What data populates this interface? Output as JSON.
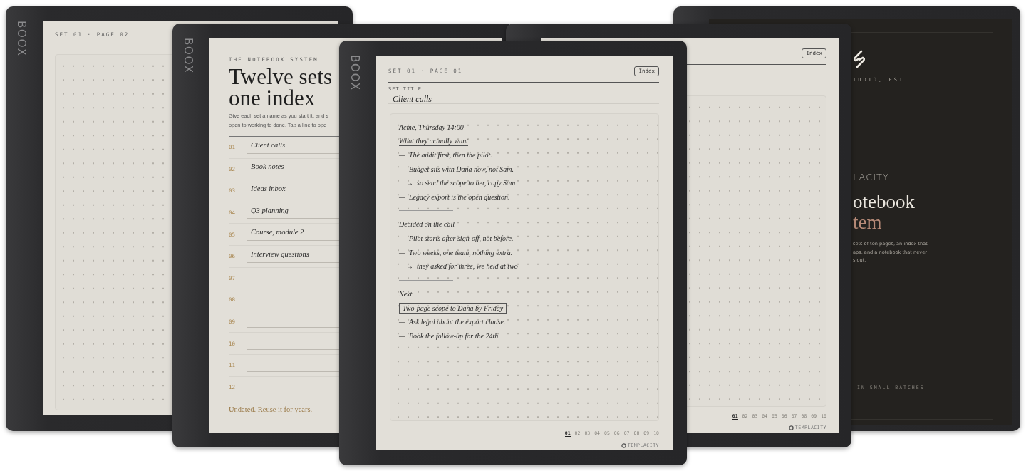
{
  "back_left_device": {
    "brand": "BOOX",
    "header": "SET 01 · PAGE 02"
  },
  "index_device": {
    "brand": "BOOX",
    "eyebrow": "THE NOTEBOOK SYSTEM",
    "title_lines": [
      "Twelve sets",
      "one index"
    ],
    "intro_lines": [
      "Give each set a name as you start it, and s",
      "open to working to done. Tap a line to ope"
    ],
    "rows": [
      {
        "number": "01",
        "name": "Client calls"
      },
      {
        "number": "02",
        "name": "Book notes"
      },
      {
        "number": "03",
        "name": "Ideas inbox"
      },
      {
        "number": "04",
        "name": "Q3 planning"
      },
      {
        "number": "05",
        "name": "Course, module 2"
      },
      {
        "number": "06",
        "name": "Interview questions"
      },
      {
        "number": "07"
      },
      {
        "number": "08"
      },
      {
        "number": "09"
      },
      {
        "number": "10"
      },
      {
        "number": "11"
      },
      {
        "number": "12"
      }
    ],
    "footer": "Undated. Reuse it for years."
  },
  "cover_device": {
    "studio_fragment": "TUDIO, EST.",
    "brand_fragment": "LACITY",
    "title_fragments": [
      "otebook",
      "tem"
    ],
    "intro_fragments": [
      "sets of ten pages, an index that",
      "aps, and a notebook that never",
      "s out."
    ],
    "tagline": "IN SMALL BATCHES"
  },
  "back_right_device": {
    "index_button": "Index",
    "pages": [
      {
        "label": "01",
        "selected": true
      },
      {
        "label": "02",
        "selected": false
      },
      {
        "label": "03",
        "selected": false
      },
      {
        "label": "04",
        "selected": false
      },
      {
        "label": "05",
        "selected": false
      },
      {
        "label": "06",
        "selected": false
      },
      {
        "label": "07",
        "selected": false
      },
      {
        "label": "08",
        "selected": false
      },
      {
        "label": "09",
        "selected": false
      },
      {
        "label": "10",
        "selected": false
      }
    ],
    "brand_mark": "TEMPLACITY"
  },
  "front_device": {
    "brand": "BOOX",
    "header": "SET 01 · PAGE 01",
    "index_button": "Index",
    "set_title_label": "SET TITLE",
    "set_title": "Client calls",
    "notes": [
      {
        "kind": "plain",
        "text": "Acme, Thursday 14:00"
      },
      {
        "kind": "heading",
        "text": "What they actually want"
      },
      {
        "kind": "bullet",
        "marker": "—",
        "text": "The audit first, then the pilot."
      },
      {
        "kind": "bullet",
        "marker": "—",
        "text": "Budget sits with Dana now, not Sam."
      },
      {
        "kind": "arrow",
        "marker": "→",
        "text": "so send the scope to her, copy Sam"
      },
      {
        "kind": "bullet",
        "marker": "—",
        "text": "Legacy export is the open question."
      },
      {
        "kind": "divider"
      },
      {
        "kind": "heading",
        "text": "Decided on the call"
      },
      {
        "kind": "bullet",
        "marker": "—",
        "text": "Pilot starts after sign-off, not before."
      },
      {
        "kind": "bullet",
        "marker": "—",
        "text": "Two weeks, one team, nothing extra."
      },
      {
        "kind": "arrow",
        "marker": "→",
        "text": "they asked for three, we held at two"
      },
      {
        "kind": "divider"
      },
      {
        "kind": "heading",
        "text": "Next"
      },
      {
        "kind": "boxed",
        "text": "Two-page scope to Dana by Friday"
      },
      {
        "kind": "bullet",
        "marker": "—",
        "text": "Ask legal about the export clause."
      },
      {
        "kind": "bullet",
        "marker": "—",
        "text": "Book the follow-up for the 24th."
      }
    ],
    "pages": [
      {
        "label": "01",
        "selected": true
      },
      {
        "label": "02",
        "selected": false
      },
      {
        "label": "03",
        "selected": false
      },
      {
        "label": "04",
        "selected": false
      },
      {
        "label": "05",
        "selected": false
      },
      {
        "label": "06",
        "selected": false
      },
      {
        "label": "07",
        "selected": false
      },
      {
        "label": "08",
        "selected": false
      },
      {
        "label": "09",
        "selected": false
      },
      {
        "label": "10",
        "selected": false
      }
    ],
    "brand_mark": "TEMPLACITY"
  }
}
